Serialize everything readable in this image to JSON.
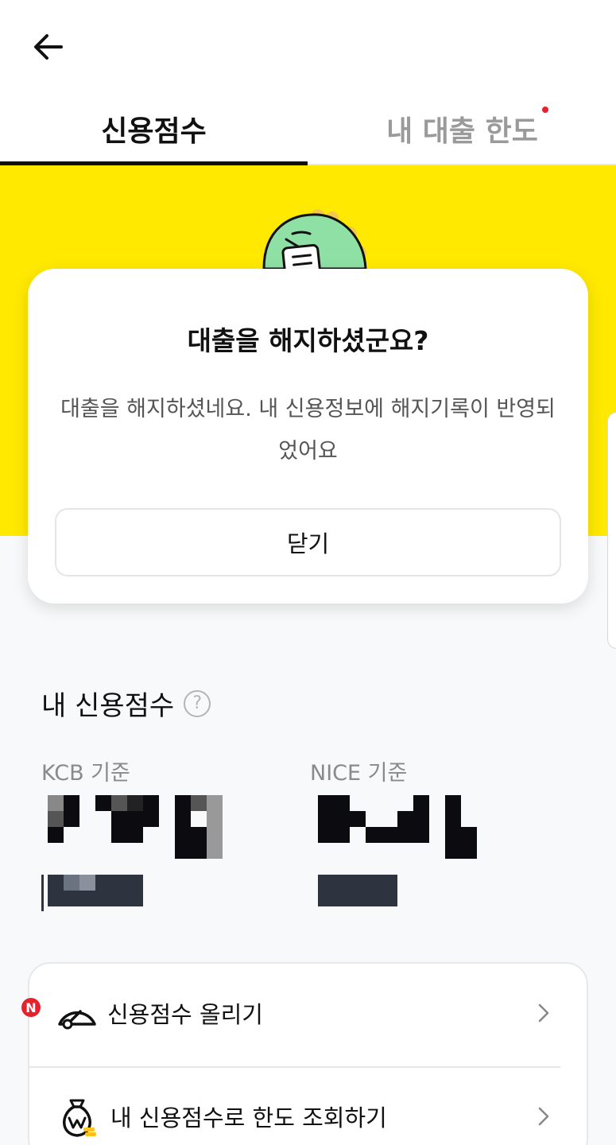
{
  "tabs": [
    {
      "label": "신용점수",
      "active": true
    },
    {
      "label": "내 대출 한도",
      "active": false,
      "has_new_dot": true
    }
  ],
  "modal": {
    "title": "대출을 해지하셨군요?",
    "description": "대출을 해지하셨네요. 내 신용정보에 해지기록이 반영되었어요",
    "close_label": "닫기"
  },
  "credit_section": {
    "title": "내 신용점수",
    "help_symbol": "?",
    "kcb_label": "KCB 기준",
    "nice_label": "NICE 기준"
  },
  "menu": {
    "items": [
      {
        "label": "신용점수 올리기",
        "badge": "N",
        "icon": "speedometer-icon"
      },
      {
        "label": "내 신용점수로 한도 조회하기",
        "icon": "money-bag-icon"
      }
    ]
  },
  "colors": {
    "brand_yellow": "#ffe900",
    "notification_red": "#e5232e"
  }
}
